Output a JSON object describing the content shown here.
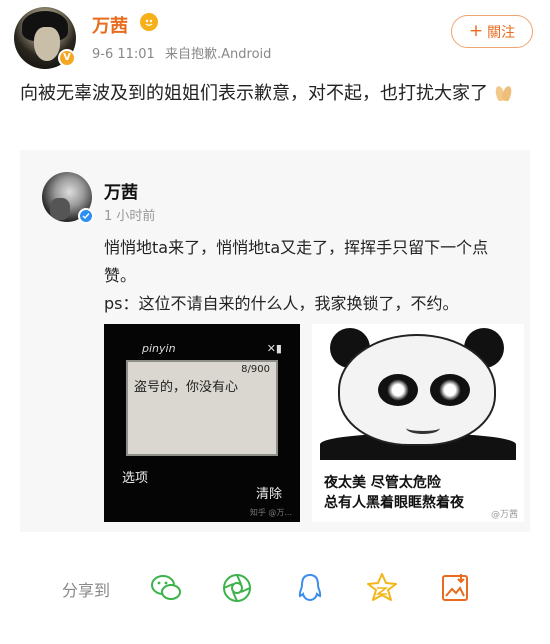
{
  "header": {
    "username": "万茜",
    "vip_badge": "V",
    "vip_icon": "crown-smile-icon",
    "post_time": "9-6 11:01",
    "source_prefix": "来自",
    "source": "抱歉.Android",
    "follow_label": "關注"
  },
  "post": {
    "text": "向被无辜波及到的姐姐们表示歉意，对不起，也打扰大家了",
    "emoji": "clap-icon"
  },
  "repost": {
    "username": "万茜",
    "time": "1 小时前",
    "text_line1": "悄悄地ta来了，悄悄地ta又走了，挥挥手只留下一个点赞。",
    "text_line2": "ps：这位不请自来的什么人，我家换锁了，不约。",
    "phone_image": {
      "title": "pinyin",
      "counter": "8/900",
      "message": "盗号的，你没有心",
      "left_softkey": "选项",
      "right_softkey": "清除",
      "watermark": "知乎 @万..."
    },
    "meme_image": {
      "caption_line1": "夜太美 尽管太危险",
      "caption_line2": "总有人黑着眼眶熬着夜",
      "watermark": "@万茜"
    }
  },
  "share_bar": {
    "label": "分享到",
    "icons": [
      "wechat-icon",
      "moments-icon",
      "qq-icon",
      "qzone-icon",
      "save-image-icon"
    ]
  },
  "colors": {
    "accent": "#e86b1e",
    "share_green": "#3bb24a",
    "share_blue": "#3c8ee8",
    "share_yellow": "#f3b518"
  }
}
